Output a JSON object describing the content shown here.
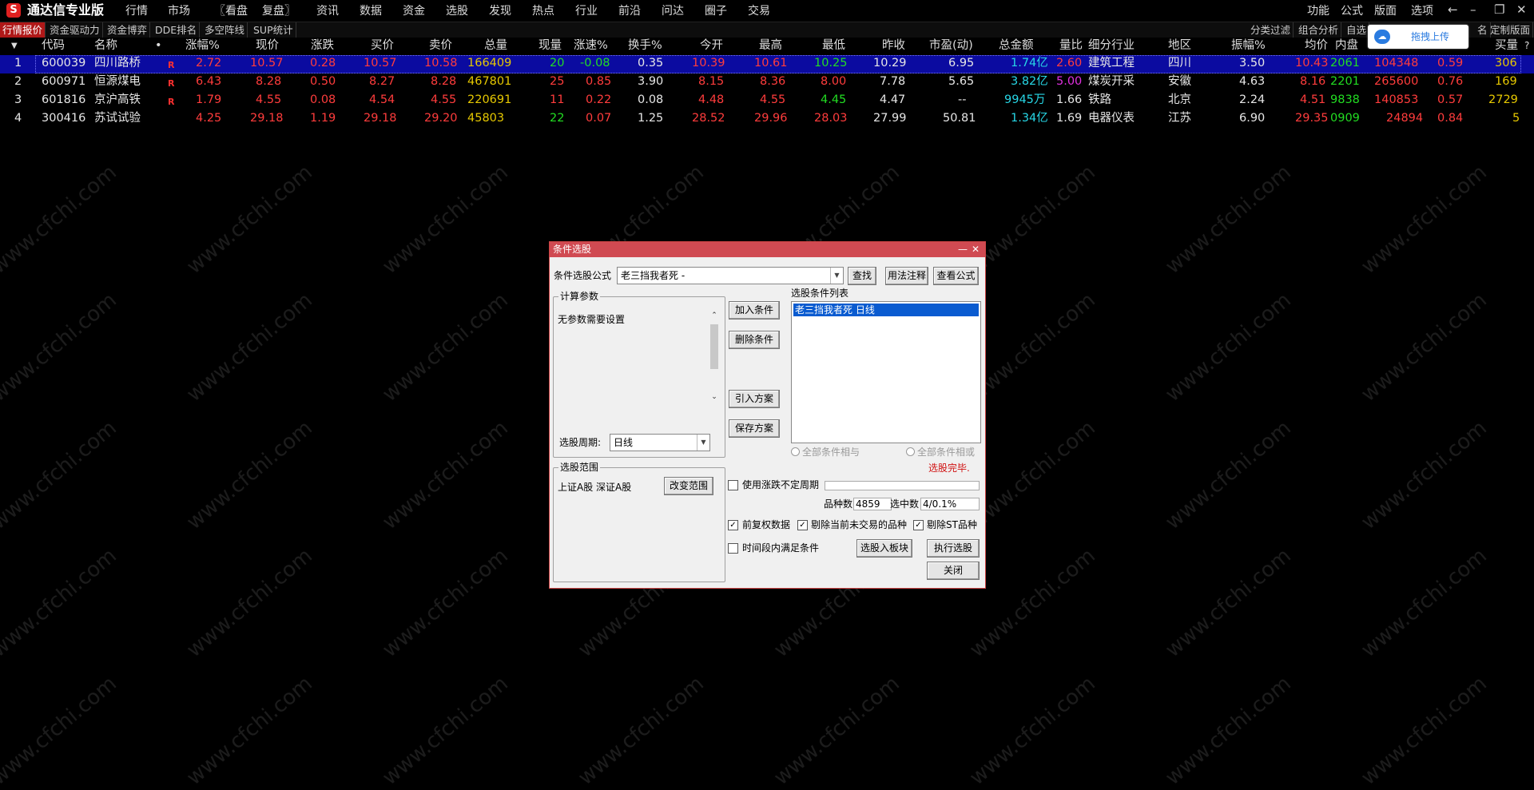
{
  "app": {
    "title": "通达信专业版"
  },
  "menu": [
    "行情",
    "市场",
    "〖看盘",
    "复盘〗",
    "资讯",
    "数据",
    "资金",
    "选股",
    "发现",
    "热点",
    "行业",
    "前沿",
    "问达",
    "圈子",
    "交易"
  ],
  "menu_right": [
    "功能",
    "公式",
    "版面",
    "选项"
  ],
  "tabs": [
    "行情报价",
    "资金驱动力",
    "资金博弈",
    "DDE排名",
    "多空阵线",
    "SUP统计"
  ],
  "tabs_right": [
    "分类过滤",
    "组合分析",
    "自选",
    "名",
    "定制版面"
  ],
  "upload_label": "拖拽上传",
  "columns": [
    "代码",
    "名称",
    "•",
    "涨幅%",
    "现价",
    "涨跌",
    "买价",
    "卖价",
    "总量",
    "现量",
    "涨速%",
    "换手%",
    "今开",
    "最高",
    "最低",
    "昨收",
    "市盈(动)",
    "总金额",
    "量比",
    "细分行业",
    "地区",
    "振幅%",
    "均价",
    "内盘",
    "买量",
    "?"
  ],
  "rows": [
    {
      "idx": "1",
      "code": "600039",
      "name": "四川路桥",
      "flag": "R",
      "chg_pct": "2.72",
      "price": "10.57",
      "chg": "0.28",
      "bid": "10.57",
      "ask": "10.58",
      "vol": "166409",
      "cur_vol": "20",
      "speed": "-0.08",
      "turnover": "0.35",
      "open": "10.39",
      "high": "10.61",
      "low": "10.25",
      "prev_close": "10.29",
      "pe": "6.95",
      "amount": "1.74亿",
      "vol_ratio": "2.60",
      "industry": "建筑工程",
      "region": "四川",
      "amplitude": "3.50",
      "avg": "10.43",
      "inner": "2061",
      "outer": "104348",
      "x1": "0.59",
      "bid_vol": "306"
    },
    {
      "idx": "2",
      "code": "600971",
      "name": "恒源煤电",
      "flag": "R",
      "chg_pct": "6.43",
      "price": "8.28",
      "chg": "0.50",
      "bid": "8.27",
      "ask": "8.28",
      "vol": "467801",
      "cur_vol": "25",
      "speed": "0.85",
      "turnover": "3.90",
      "open": "8.15",
      "high": "8.36",
      "low": "8.00",
      "prev_close": "7.78",
      "pe": "5.65",
      "amount": "3.82亿",
      "vol_ratio": "5.00",
      "industry": "煤炭开采",
      "region": "安徽",
      "amplitude": "4.63",
      "avg": "8.16",
      "inner": "2201",
      "outer": "265600",
      "x1": "0.76",
      "bid_vol": "169"
    },
    {
      "idx": "3",
      "code": "601816",
      "name": "京沪高铁",
      "flag": "R",
      "chg_pct": "1.79",
      "price": "4.55",
      "chg": "0.08",
      "bid": "4.54",
      "ask": "4.55",
      "vol": "220691",
      "cur_vol": "11",
      "speed": "0.22",
      "turnover": "0.08",
      "open": "4.48",
      "high": "4.55",
      "low": "4.45",
      "prev_close": "4.47",
      "pe": "--",
      "amount": "9945万",
      "vol_ratio": "1.66",
      "industry": "铁路",
      "region": "北京",
      "amplitude": "2.24",
      "avg": "4.51",
      "inner": "9838",
      "outer": "140853",
      "x1": "0.57",
      "bid_vol": "2729"
    },
    {
      "idx": "4",
      "code": "300416",
      "name": "苏试试验",
      "flag": "",
      "chg_pct": "4.25",
      "price": "29.18",
      "chg": "1.19",
      "bid": "29.18",
      "ask": "29.20",
      "vol": "45803",
      "cur_vol": "22",
      "speed": "0.07",
      "turnover": "1.25",
      "open": "28.52",
      "high": "29.96",
      "low": "28.03",
      "prev_close": "27.99",
      "pe": "50.81",
      "amount": "1.34亿",
      "vol_ratio": "1.69",
      "industry": "电器仪表",
      "region": "江苏",
      "amplitude": "6.90",
      "avg": "29.35",
      "inner": "0909",
      "outer": "24894",
      "x1": "0.84",
      "bid_vol": "5"
    }
  ],
  "watermark": "www.cfchi.com",
  "dialog": {
    "title": "条件选股",
    "formula_label": "条件选股公式",
    "formula_value": "老三挡我者死 -",
    "find": "查找",
    "usage": "用法注释",
    "view_formula": "查看公式",
    "params_group": "计算参数",
    "no_params": "无参数需要设置",
    "period_label": "选股周期:",
    "period_value": "日线",
    "add_cond": "加入条件",
    "del_cond": "删除条件",
    "import_plan": "引入方案",
    "save_plan": "保存方案",
    "cond_list_label": "选股条件列表",
    "cond_item": "老三挡我者死  日线",
    "all_and": "全部条件相与",
    "all_or": "全部条件相或",
    "done": "选股完毕.",
    "range_group": "选股范围",
    "range_value": "上证A股 深证A股",
    "change_range": "改变范围",
    "use_uncertain": "使用涨跌不定周期",
    "count_label": "品种数",
    "count_value": "4859",
    "selected_label": "选中数",
    "selected_value": "4/0.1%",
    "fq": "前复权数据",
    "del_untraded": "剔除当前未交易的品种",
    "del_st": "剔除ST品种",
    "time_cond": "时间段内满足条件",
    "to_block": "选股入板块",
    "execute": "执行选股",
    "close": "关闭"
  }
}
